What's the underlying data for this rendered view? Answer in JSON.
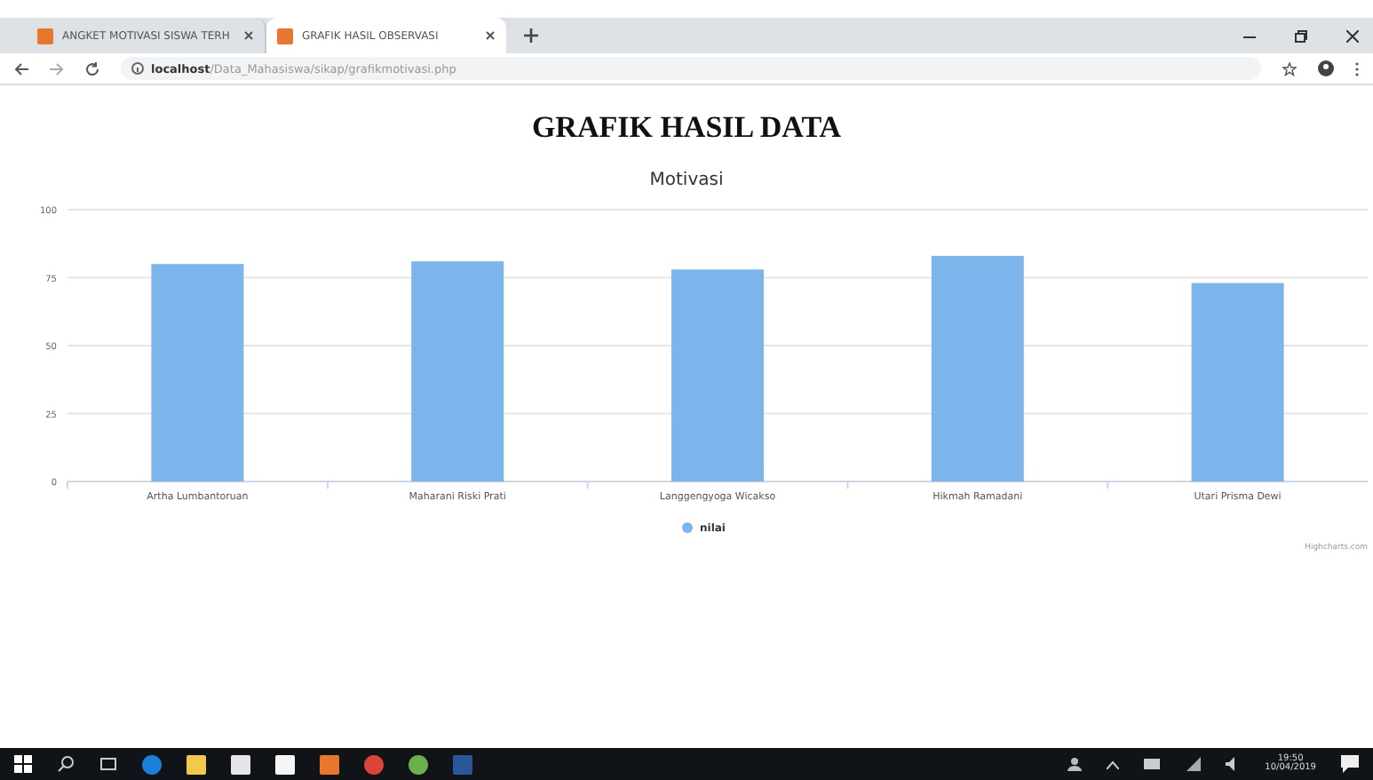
{
  "browser": {
    "tabs": [
      {
        "title": "ANGKET MOTIVASI SISWA TERH",
        "selected": false
      },
      {
        "title": "GRAFIK HASIL OBSERVASI",
        "selected": true
      }
    ],
    "url_host": "localhost",
    "url_path": "/Data_Mahasiswa/sikap/grafikmotivasi.php"
  },
  "page": {
    "heading": "GRAFIK HASIL DATA",
    "chart": {
      "chart_data": {
        "type": "bar",
        "title": "Motivasi",
        "categories": [
          "Artha Lumbantoruan",
          "Maharani Riski Prati",
          "Langgengyoga Wicakso",
          "Hikmah Ramadani",
          "Utari Prisma Dewi"
        ],
        "series": [
          {
            "name": "nilai",
            "color": "#7cb5ec",
            "values": [
              80,
              81,
              78,
              83,
              73
            ]
          }
        ],
        "ylim": [
          0,
          100
        ],
        "grid": true,
        "yticks": [
          0,
          25,
          50,
          75,
          100
        ]
      },
      "credits": "Highcharts.com"
    }
  },
  "taskbar": {
    "time": "19:50",
    "date": "10/04/2019"
  }
}
